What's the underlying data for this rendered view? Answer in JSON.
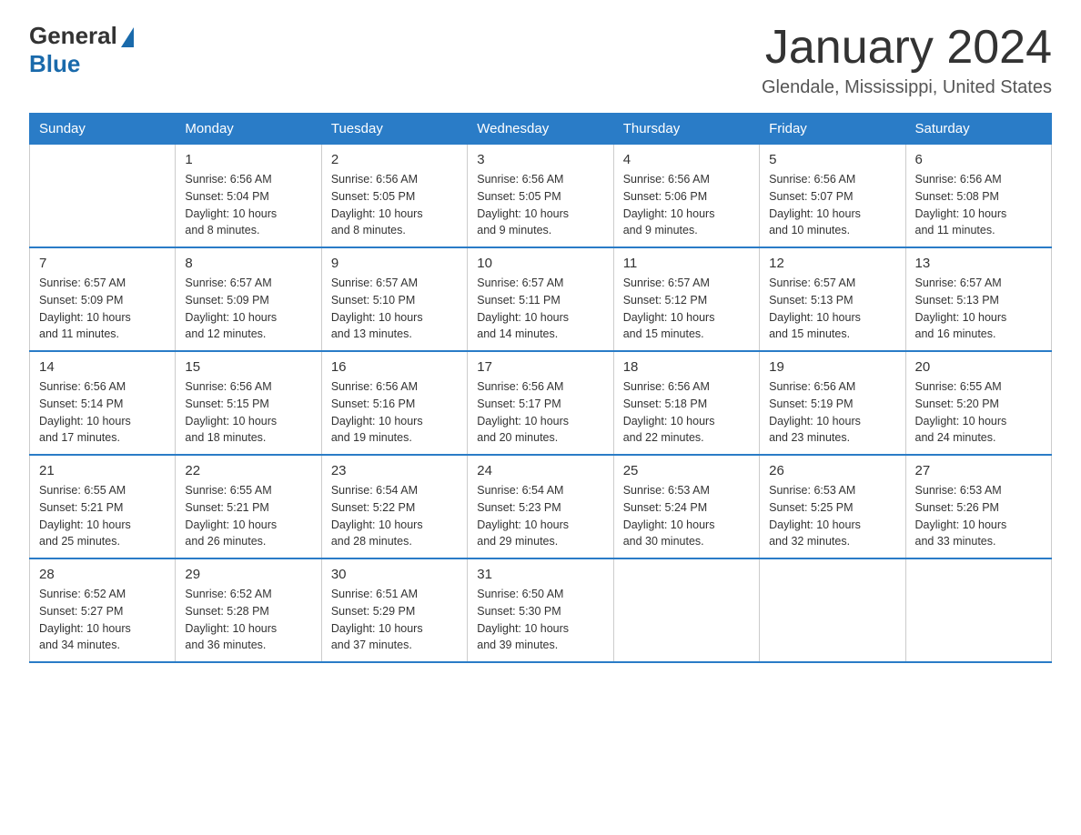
{
  "header": {
    "logo_general": "General",
    "logo_blue": "Blue",
    "month_title": "January 2024",
    "location": "Glendale, Mississippi, United States"
  },
  "days_of_week": [
    "Sunday",
    "Monday",
    "Tuesday",
    "Wednesday",
    "Thursday",
    "Friday",
    "Saturday"
  ],
  "weeks": [
    [
      {
        "day": "",
        "info": ""
      },
      {
        "day": "1",
        "info": "Sunrise: 6:56 AM\nSunset: 5:04 PM\nDaylight: 10 hours\nand 8 minutes."
      },
      {
        "day": "2",
        "info": "Sunrise: 6:56 AM\nSunset: 5:05 PM\nDaylight: 10 hours\nand 8 minutes."
      },
      {
        "day": "3",
        "info": "Sunrise: 6:56 AM\nSunset: 5:05 PM\nDaylight: 10 hours\nand 9 minutes."
      },
      {
        "day": "4",
        "info": "Sunrise: 6:56 AM\nSunset: 5:06 PM\nDaylight: 10 hours\nand 9 minutes."
      },
      {
        "day": "5",
        "info": "Sunrise: 6:56 AM\nSunset: 5:07 PM\nDaylight: 10 hours\nand 10 minutes."
      },
      {
        "day": "6",
        "info": "Sunrise: 6:56 AM\nSunset: 5:08 PM\nDaylight: 10 hours\nand 11 minutes."
      }
    ],
    [
      {
        "day": "7",
        "info": "Sunrise: 6:57 AM\nSunset: 5:09 PM\nDaylight: 10 hours\nand 11 minutes."
      },
      {
        "day": "8",
        "info": "Sunrise: 6:57 AM\nSunset: 5:09 PM\nDaylight: 10 hours\nand 12 minutes."
      },
      {
        "day": "9",
        "info": "Sunrise: 6:57 AM\nSunset: 5:10 PM\nDaylight: 10 hours\nand 13 minutes."
      },
      {
        "day": "10",
        "info": "Sunrise: 6:57 AM\nSunset: 5:11 PM\nDaylight: 10 hours\nand 14 minutes."
      },
      {
        "day": "11",
        "info": "Sunrise: 6:57 AM\nSunset: 5:12 PM\nDaylight: 10 hours\nand 15 minutes."
      },
      {
        "day": "12",
        "info": "Sunrise: 6:57 AM\nSunset: 5:13 PM\nDaylight: 10 hours\nand 15 minutes."
      },
      {
        "day": "13",
        "info": "Sunrise: 6:57 AM\nSunset: 5:13 PM\nDaylight: 10 hours\nand 16 minutes."
      }
    ],
    [
      {
        "day": "14",
        "info": "Sunrise: 6:56 AM\nSunset: 5:14 PM\nDaylight: 10 hours\nand 17 minutes."
      },
      {
        "day": "15",
        "info": "Sunrise: 6:56 AM\nSunset: 5:15 PM\nDaylight: 10 hours\nand 18 minutes."
      },
      {
        "day": "16",
        "info": "Sunrise: 6:56 AM\nSunset: 5:16 PM\nDaylight: 10 hours\nand 19 minutes."
      },
      {
        "day": "17",
        "info": "Sunrise: 6:56 AM\nSunset: 5:17 PM\nDaylight: 10 hours\nand 20 minutes."
      },
      {
        "day": "18",
        "info": "Sunrise: 6:56 AM\nSunset: 5:18 PM\nDaylight: 10 hours\nand 22 minutes."
      },
      {
        "day": "19",
        "info": "Sunrise: 6:56 AM\nSunset: 5:19 PM\nDaylight: 10 hours\nand 23 minutes."
      },
      {
        "day": "20",
        "info": "Sunrise: 6:55 AM\nSunset: 5:20 PM\nDaylight: 10 hours\nand 24 minutes."
      }
    ],
    [
      {
        "day": "21",
        "info": "Sunrise: 6:55 AM\nSunset: 5:21 PM\nDaylight: 10 hours\nand 25 minutes."
      },
      {
        "day": "22",
        "info": "Sunrise: 6:55 AM\nSunset: 5:21 PM\nDaylight: 10 hours\nand 26 minutes."
      },
      {
        "day": "23",
        "info": "Sunrise: 6:54 AM\nSunset: 5:22 PM\nDaylight: 10 hours\nand 28 minutes."
      },
      {
        "day": "24",
        "info": "Sunrise: 6:54 AM\nSunset: 5:23 PM\nDaylight: 10 hours\nand 29 minutes."
      },
      {
        "day": "25",
        "info": "Sunrise: 6:53 AM\nSunset: 5:24 PM\nDaylight: 10 hours\nand 30 minutes."
      },
      {
        "day": "26",
        "info": "Sunrise: 6:53 AM\nSunset: 5:25 PM\nDaylight: 10 hours\nand 32 minutes."
      },
      {
        "day": "27",
        "info": "Sunrise: 6:53 AM\nSunset: 5:26 PM\nDaylight: 10 hours\nand 33 minutes."
      }
    ],
    [
      {
        "day": "28",
        "info": "Sunrise: 6:52 AM\nSunset: 5:27 PM\nDaylight: 10 hours\nand 34 minutes."
      },
      {
        "day": "29",
        "info": "Sunrise: 6:52 AM\nSunset: 5:28 PM\nDaylight: 10 hours\nand 36 minutes."
      },
      {
        "day": "30",
        "info": "Sunrise: 6:51 AM\nSunset: 5:29 PM\nDaylight: 10 hours\nand 37 minutes."
      },
      {
        "day": "31",
        "info": "Sunrise: 6:50 AM\nSunset: 5:30 PM\nDaylight: 10 hours\nand 39 minutes."
      },
      {
        "day": "",
        "info": ""
      },
      {
        "day": "",
        "info": ""
      },
      {
        "day": "",
        "info": ""
      }
    ]
  ]
}
